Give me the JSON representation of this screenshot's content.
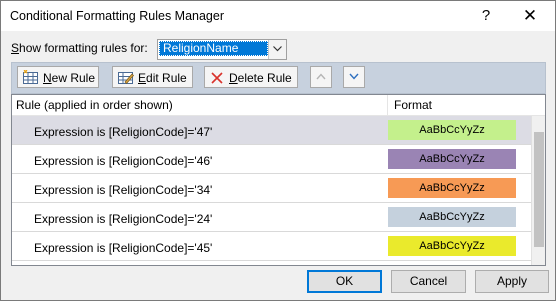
{
  "window": {
    "title": "Conditional Formatting Rules Manager",
    "help_label": "?",
    "close_label": "✕"
  },
  "filter": {
    "label_prefix": "",
    "label_mnemonic": "S",
    "label_rest": "how formatting rules for:",
    "selected_value": "ReligionName"
  },
  "toolbar": {
    "new_rule_mnemonic": "N",
    "new_rule_rest": "ew Rule",
    "edit_rule_mnemonic": "E",
    "edit_rule_rest": "dit Rule",
    "delete_rule_mnemonic": "D",
    "delete_rule_rest": "elete Rule"
  },
  "list": {
    "columns": {
      "rule": "Rule (applied in order shown)",
      "format": "Format"
    },
    "rows": [
      {
        "rule": "Expression is [ReligionCode]='47'",
        "format_preview": "AaBbCcYyZz",
        "color": "#c4f08c",
        "selected": true
      },
      {
        "rule": "Expression is [ReligionCode]='46'",
        "format_preview": "AaBbCcYyZz",
        "color": "#9a84b4",
        "selected": false
      },
      {
        "rule": "Expression is [ReligionCode]='34'",
        "format_preview": "AaBbCcYyZz",
        "color": "#f79a55",
        "selected": false
      },
      {
        "rule": "Expression is [ReligionCode]='24'",
        "format_preview": "AaBbCcYyZz",
        "color": "#c5d1dd",
        "selected": false
      },
      {
        "rule": "Expression is [ReligionCode]='45'",
        "format_preview": "AaBbCcYyZz",
        "color": "#eaea2c",
        "selected": false
      }
    ]
  },
  "buttons": {
    "ok": "OK",
    "cancel": "Cancel",
    "apply": "Apply"
  }
}
